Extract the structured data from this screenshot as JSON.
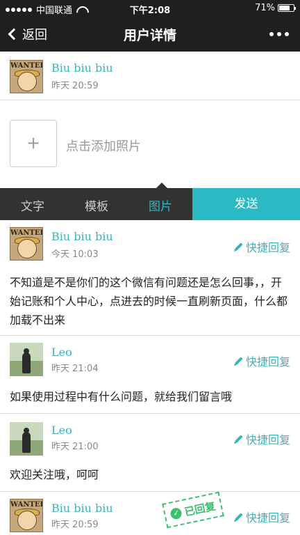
{
  "statusbar": {
    "carrier": "中国联通",
    "time": "下午2:08",
    "battery": "71%"
  },
  "navbar": {
    "back_label": "返回",
    "title": "用户详情"
  },
  "top_message": {
    "name": "Biu biu biu",
    "time": "昨天 20:59",
    "avatar_label": "WANTED"
  },
  "photo": {
    "add_symbol": "+",
    "add_label": "点击添加照片"
  },
  "tabs": {
    "items": [
      "文字",
      "模板",
      "图片"
    ],
    "active": "图片",
    "send_label": "发送"
  },
  "quick_reply_label": "快捷回复",
  "messages": [
    {
      "name": "Biu biu biu",
      "time": "今天 10:03",
      "avatar_label": "WANTED",
      "text": "不知道是不是你们的这个微信有问题还是怎么回事，，开始记账和个人中心，点进去的时候一直刷新页面，什么都加载不出来"
    },
    {
      "name": "Leo",
      "time": "昨天 21:04",
      "text": "如果使用过程中有什么问题，就给我们留言哦"
    },
    {
      "name": "Leo",
      "time": "昨天 21:00",
      "text": "欢迎关注哦，呵呵"
    },
    {
      "name": "Biu biu biu",
      "time": "昨天 20:59",
      "avatar_label": "WANTED",
      "stamp": "已回复"
    }
  ],
  "colors": {
    "accent": "#35b6bf",
    "send": "#2bb9c3",
    "dark": "#1f1f1f",
    "stamp": "#3cbf6e"
  }
}
